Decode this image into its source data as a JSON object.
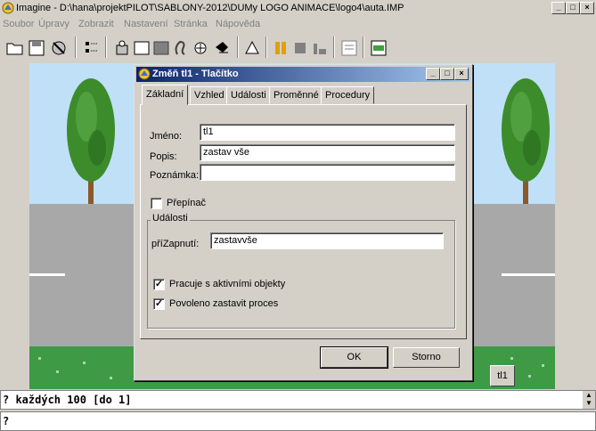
{
  "window": {
    "title": "Imagine - D:\\hana\\projektPILOT\\SABLONY-2012\\DUMy LOGO ANIMACE\\logo4\\auta.IMP",
    "controls": [
      "_",
      "□",
      "×"
    ]
  },
  "menubar": {
    "items": [
      "Soubor",
      "Úpravy",
      "Zobrazit",
      "Nastavení",
      "Stránka",
      "Nápověda"
    ]
  },
  "toolbar": {
    "icons": [
      "open-folder-icon",
      "save-icon",
      "tools-icon",
      "turtle-icon",
      "button-tool-icon",
      "panel-icon",
      "edit-icon",
      "shape-icon",
      "pointer-icon",
      "run-icon",
      "pause-icon",
      "stop-icon",
      "run-fast-icon",
      "page-icon",
      "new-page-icon"
    ]
  },
  "canvas": {
    "button_label": "tl1"
  },
  "dialog": {
    "title": "Změň tl1 - Tlačítko",
    "tabs": [
      "Základní",
      "Vzhled",
      "Události",
      "Proměnné",
      "Procedury"
    ],
    "active_tab": "Základní",
    "fields": {
      "name_label": "Jméno:",
      "name_value": "tl1",
      "desc_label": "Popis:",
      "desc_value": "zastav vše",
      "note_label": "Poznámka:",
      "note_value": ""
    },
    "toggle_label": "Přepínač",
    "toggle_checked": false,
    "events_legend": "Události",
    "on_press_label": "příZapnutí:",
    "on_press_value": "zastavvše",
    "active_objects_label": "Pracuje s aktivními objekty",
    "active_objects_checked": true,
    "allow_stop_label": "Povoleno zastavit proces",
    "allow_stop_checked": true,
    "ok_label": "OK",
    "cancel_label": "Storno"
  },
  "command": {
    "history_line": "? každých 100 [do 1]",
    "input_line": "?"
  },
  "colors": {
    "sky": "#c0e0f8",
    "road": "#a8a8a8",
    "grass": "#3e9a44",
    "title_gradient_start": "#0a246a",
    "title_gradient_end": "#a6caf0"
  }
}
